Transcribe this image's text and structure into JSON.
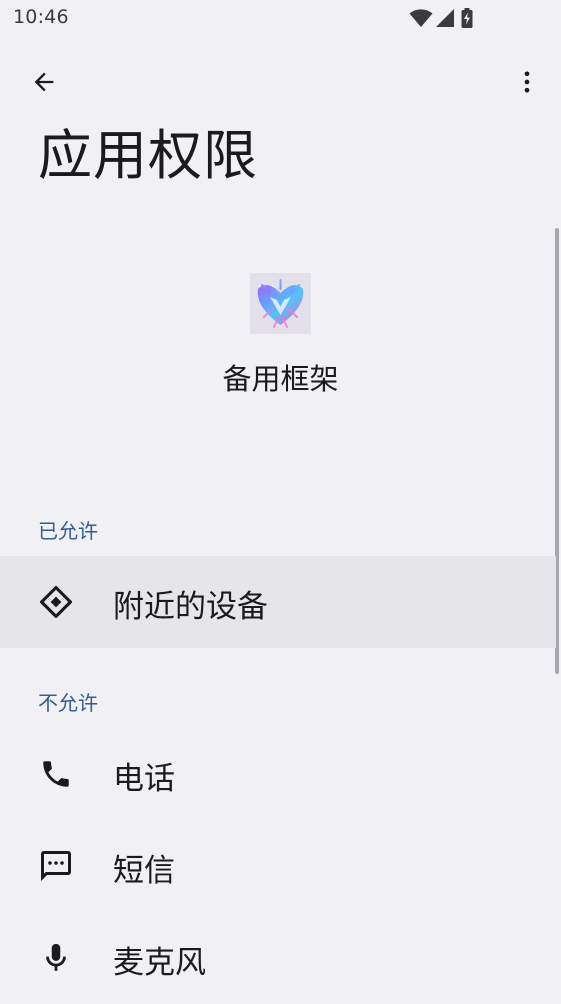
{
  "status_bar": {
    "time": "10:46",
    "icons": [
      "wifi-icon",
      "cell-signal-icon",
      "battery-charging-icon"
    ]
  },
  "app_bar": {
    "back_icon": "arrow-back-icon",
    "more_icon": "more-vert-icon"
  },
  "page": {
    "title": "应用权限"
  },
  "app": {
    "name": "备用框架",
    "icon": "app-logo-icon"
  },
  "sections": {
    "allowed": {
      "header": "已允许",
      "items": [
        {
          "label": "附近的设备",
          "icon": "nearby-devices-icon"
        }
      ]
    },
    "denied": {
      "header": "不允许",
      "items": [
        {
          "label": "电话",
          "icon": "phone-icon"
        },
        {
          "label": "短信",
          "icon": "sms-icon"
        },
        {
          "label": "麦克风",
          "icon": "microphone-icon"
        }
      ]
    }
  },
  "colors": {
    "background": "#F1F0F4",
    "section_header": "#335C8F",
    "highlight_row": "#E6E5EA",
    "text_primary": "#1B1B1F"
  }
}
